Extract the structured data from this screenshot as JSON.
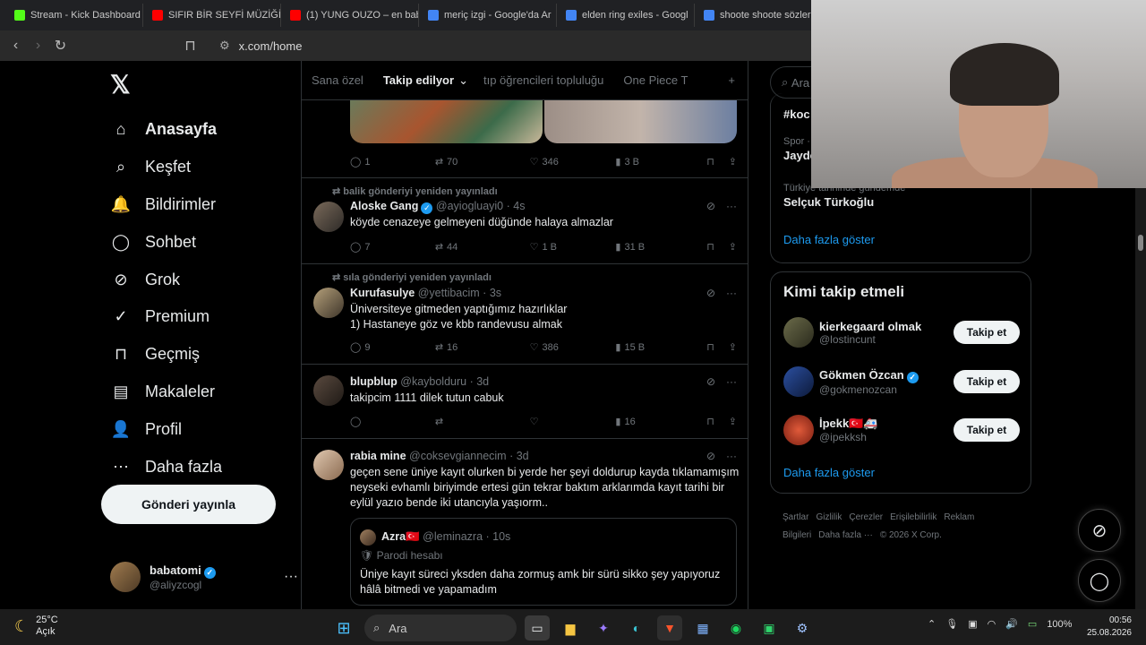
{
  "browser": {
    "tabs": [
      {
        "title": "Stream - Kick Dashboard",
        "color": "#53fc18"
      },
      {
        "title": "SIFIR BİR SEYFİ MÜZİĞİ -",
        "color": "#ff0000"
      },
      {
        "title": "(1) YUNG OUZO – en bab",
        "color": "#ff0000"
      },
      {
        "title": "meriç izgi - Google'da Ar",
        "color": "#4285f4"
      },
      {
        "title": "elden ring exiles - Googl",
        "color": "#4285f4"
      },
      {
        "title": "shoote shoote sözler - G",
        "color": "#4285f4"
      }
    ],
    "url": "x.com/home"
  },
  "sidebar": {
    "logo": "𝕏",
    "items": [
      {
        "label": "Anasayfa",
        "icon": "⌂"
      },
      {
        "label": "Keşfet",
        "icon": "⌕"
      },
      {
        "label": "Bildirimler",
        "icon": "🔔"
      },
      {
        "label": "Sohbet",
        "icon": "◯"
      },
      {
        "label": "Grok",
        "icon": "⊘"
      },
      {
        "label": "Premium",
        "icon": "✓"
      },
      {
        "label": "Geçmiş",
        "icon": "⊓"
      },
      {
        "label": "Makaleler",
        "icon": "▤"
      },
      {
        "label": "Profil",
        "icon": "👤"
      },
      {
        "label": "Daha fazla",
        "icon": "⋯"
      }
    ],
    "post_button": "Gönderi yayınla",
    "account": {
      "name": "babatomi",
      "handle": "@aliyzcogl"
    }
  },
  "timeline": {
    "tabs": [
      "Sana özel",
      "Takip edilyor",
      "tıp öğrencileri topluluğu",
      "One Piece T"
    ],
    "plus": "+",
    "first_actions": {
      "reply": "1",
      "repost": "70",
      "like": "346",
      "views": "3 B"
    },
    "tweets": [
      {
        "retweeted_by": "balik gönderiyi yeniden yayınladı",
        "name": "Aloske Gang",
        "verified": true,
        "handle": "@ayiogluayi0",
        "time": "4s",
        "text": "köyde cenazeye gelmeyeni düğünde halaya almazlar",
        "reply": "7",
        "repost": "44",
        "like": "1 B",
        "views": "31 B"
      },
      {
        "retweeted_by": "sıla gönderiyi yeniden yayınladı",
        "name": "Kurufasulye",
        "verified": false,
        "handle": "@yettibacim",
        "time": "3s",
        "text": "Üniversiteye gitmeden yaptığımız hazırlıklar\n1) Hastaneye göz ve kbb randevusu almak",
        "reply": "9",
        "repost": "16",
        "like": "386",
        "views": "15 B"
      },
      {
        "retweeted_by": "",
        "name": "blupblup",
        "verified": false,
        "handle": "@kaybolduru",
        "time": "3d",
        "text": "takipcim 1111 dilek tutun cabuk",
        "reply": "",
        "repost": "",
        "like": "",
        "views": "16"
      },
      {
        "retweeted_by": "",
        "name": "rabia mine",
        "verified": false,
        "handle": "@coksevgiannecim",
        "time": "3d",
        "text": "geçen sene üniye kayıt olurken bi yerde her şeyi doldurup kayda tıklamamışım neyseki evhamlı biriyimde ertesi gün tekrar baktım arklarımda kayıt tarihi bir eylül yazıo bende iki utancıyla yaşıorm..",
        "quote": {
          "name": "Azra",
          "flag": "🇹🇷",
          "handle": "@leminazra",
          "time": "10s",
          "label": "Parodi hesabı",
          "text": "Üniye kayıt süreci yksden daha zormuş amk bir sürü sikko şey yapıyoruz hâlâ bitmedi ve yapamadım"
        }
      }
    ]
  },
  "right": {
    "search_placeholder": "Ara",
    "trends": [
      {
        "context": "",
        "name": "#koc"
      },
      {
        "context": "Spor ·",
        "name": "Jayde"
      },
      {
        "context": "Türkiye tarihinde gündemde",
        "name": "Selçuk Türkoğlu"
      }
    ],
    "show_more": "Daha fazla göster",
    "who_to_follow": {
      "title": "Kimi takip etmeli",
      "people": [
        {
          "name": "kierkegaard olmak",
          "handle": "@lostincunt",
          "verified": false
        },
        {
          "name": "Gökmen Özcan",
          "handle": "@gokmenozcan",
          "verified": true
        },
        {
          "name": "İpekk🇹🇷🚑",
          "handle": "@ipekksh",
          "verified": false
        }
      ],
      "follow_label": "Takip et",
      "show_more": "Daha fazla göster"
    },
    "footer": [
      "Şartlar",
      "Gizlilik",
      "Çerezler",
      "Erişilebilirlik",
      "Reklam Bilgileri",
      "Daha fazla ···",
      "© 2026 X Corp."
    ]
  },
  "taskbar": {
    "weather_temp": "25°C",
    "weather_desc": "Açık",
    "search": "Ara",
    "battery": "100%",
    "time": "00:56",
    "date": "25.08.2026"
  }
}
